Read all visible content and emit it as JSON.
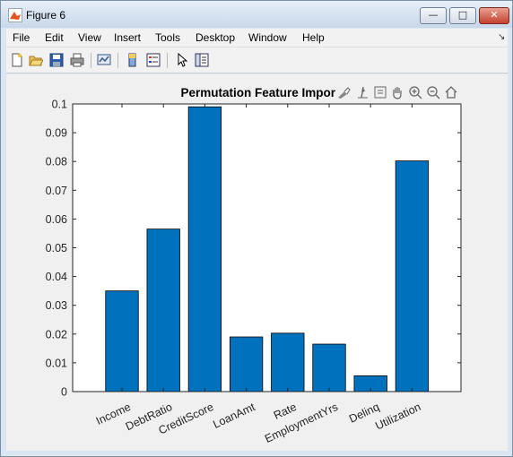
{
  "window": {
    "title": "Figure 6",
    "minimize_glyph": "—",
    "maximize_glyph": "□",
    "close_glyph": "✕"
  },
  "menu": [
    "File",
    "Edit",
    "View",
    "Insert",
    "Tools",
    "Desktop",
    "Window",
    "Help"
  ],
  "axes_toolbar_icons": [
    "brush-icon",
    "data-cursor-icon",
    "restore-view-icon",
    "pan-icon",
    "zoom-in-icon",
    "zoom-out-icon",
    "home-icon"
  ],
  "toolbar_icons": [
    "new-figure-icon",
    "open-file-icon",
    "save-icon",
    "print-icon",
    "link-plot-icon",
    "colorbar-icon",
    "legend-icon",
    "edit-plot-icon",
    "property-inspector-icon"
  ],
  "colors": {
    "bar": "#0072BD",
    "canvas": "#f0f0f0"
  },
  "chart_data": {
    "type": "bar",
    "title": "Permutation Feature Impor",
    "categories": [
      "Income",
      "DebtRatio",
      "CreditScore",
      "LoanAmt",
      "Rate",
      "EmploymentYrs",
      "Delinq",
      "Utilization"
    ],
    "values": [
      0.035,
      0.0565,
      0.099,
      0.019,
      0.0203,
      0.0165,
      0.0055,
      0.0802
    ],
    "ylim": [
      0,
      0.1
    ],
    "yticks": [
      "0",
      "0.01",
      "0.02",
      "0.03",
      "0.04",
      "0.05",
      "0.06",
      "0.07",
      "0.08",
      "0.09",
      "0.1"
    ],
    "xlabel": "",
    "ylabel": "",
    "grid": false
  }
}
